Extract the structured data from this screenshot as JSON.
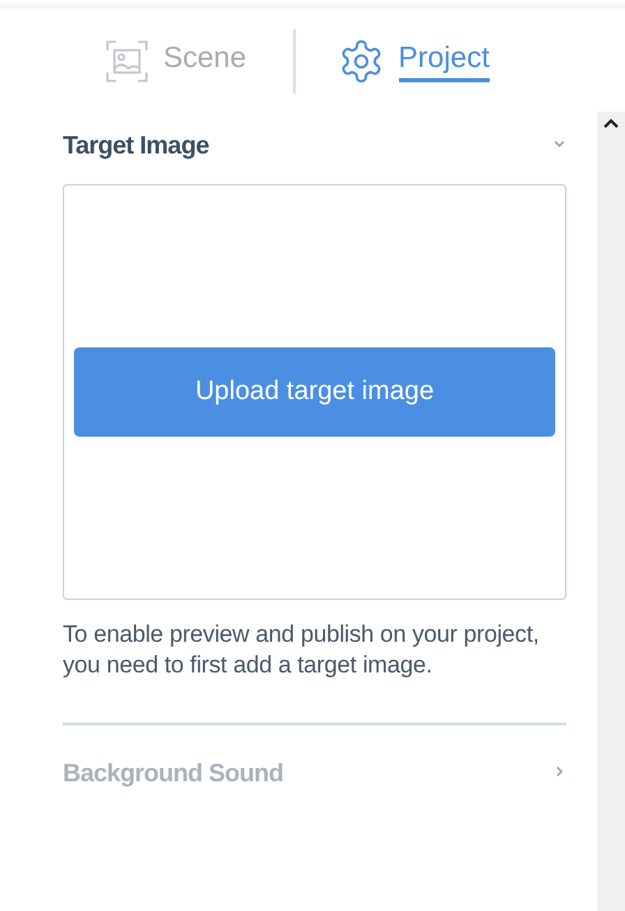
{
  "tabs": [
    {
      "label": "Scene",
      "kind": "image",
      "selected": false
    },
    {
      "label": "Project",
      "kind": "gear",
      "selected": true
    }
  ],
  "sections": [
    {
      "title": "Target Image",
      "expanded": true,
      "disabled": false,
      "upload_button": "Upload target image",
      "note": "To enable preview and publish on your project, you need to first add a target image."
    },
    {
      "title": "Background Sound",
      "expanded": false,
      "disabled": true
    }
  ]
}
